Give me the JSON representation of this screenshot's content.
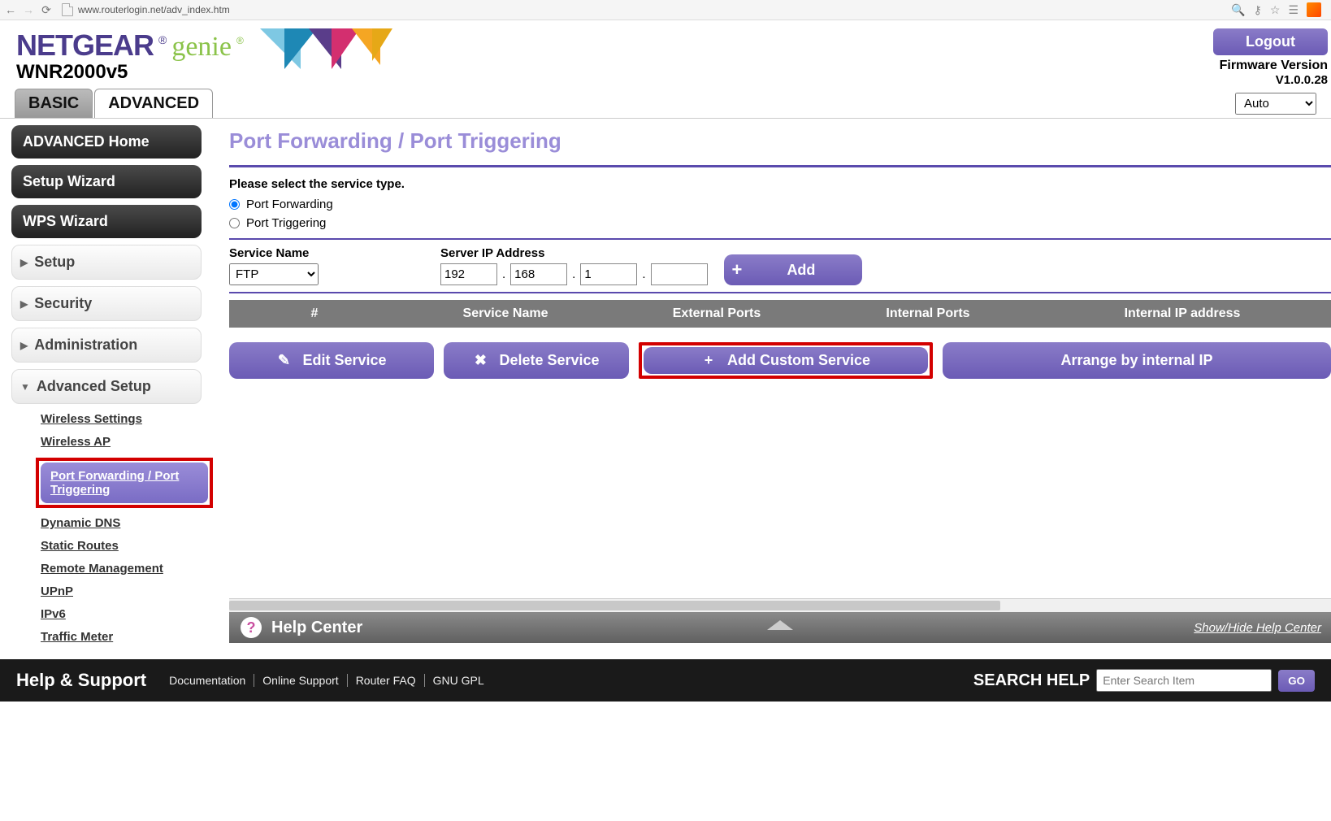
{
  "browser": {
    "url": "www.routerlogin.net/adv_index.htm"
  },
  "header": {
    "brand1": "NETGEAR",
    "brand2": "genie",
    "model": "WNR2000v5",
    "logout": "Logout",
    "fw_label": "Firmware Version",
    "fw_value": "V1.0.0.28",
    "auto_option": "Auto"
  },
  "tabs": {
    "basic": "BASIC",
    "advanced": "ADVANCED"
  },
  "sidebar": {
    "home": "ADVANCED Home",
    "setup_wizard": "Setup Wizard",
    "wps_wizard": "WPS Wizard",
    "setup": "Setup",
    "security": "Security",
    "administration": "Administration",
    "advanced_setup": "Advanced Setup",
    "sub": {
      "wireless_settings": "Wireless Settings",
      "wireless_ap": "Wireless AP",
      "port_fwd": "Port Forwarding / Port Triggering",
      "ddns": "Dynamic DNS",
      "static_routes": "Static Routes",
      "remote_mgmt": "Remote Management",
      "upnp": "UPnP",
      "ipv6": "IPv6",
      "traffic_meter": "Traffic Meter"
    }
  },
  "content": {
    "title": "Port Forwarding / Port Triggering",
    "select_service": "Please select the service type.",
    "radio_fwd": "Port Forwarding",
    "radio_trig": "Port Triggering",
    "service_name_label": "Service Name",
    "service_name_value": "FTP",
    "server_ip_label": "Server IP Address",
    "ip": {
      "a": "192",
      "b": "168",
      "c": "1",
      "d": ""
    },
    "add": "Add",
    "columns": {
      "num": "#",
      "name": "Service Name",
      "ext": "External Ports",
      "int": "Internal Ports",
      "ip": "Internal IP address"
    },
    "actions": {
      "edit": "Edit Service",
      "delete": "Delete Service",
      "custom": "Add Custom Service",
      "arrange": "Arrange by internal IP"
    }
  },
  "help_center": {
    "title": "Help Center",
    "show_hide": "Show/Hide Help Center"
  },
  "footer": {
    "title": "Help & Support",
    "links": {
      "doc": "Documentation",
      "online": "Online Support",
      "faq": "Router FAQ",
      "gpl": "GNU GPL"
    },
    "search_label": "SEARCH HELP",
    "search_placeholder": "Enter Search Item",
    "go": "GO"
  }
}
